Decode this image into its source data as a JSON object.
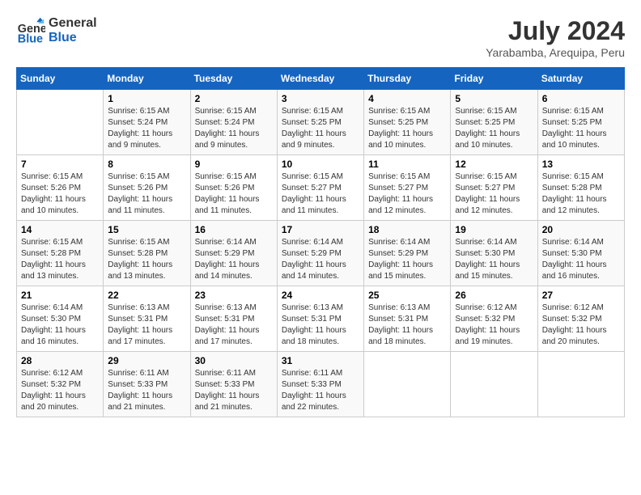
{
  "logo": {
    "line1": "General",
    "line2": "Blue"
  },
  "title": "July 2024",
  "location": "Yarabamba, Arequipa, Peru",
  "weekdays": [
    "Sunday",
    "Monday",
    "Tuesday",
    "Wednesday",
    "Thursday",
    "Friday",
    "Saturday"
  ],
  "weeks": [
    [
      {
        "day": "",
        "info": ""
      },
      {
        "day": "1",
        "info": "Sunrise: 6:15 AM\nSunset: 5:24 PM\nDaylight: 11 hours\nand 9 minutes."
      },
      {
        "day": "2",
        "info": "Sunrise: 6:15 AM\nSunset: 5:24 PM\nDaylight: 11 hours\nand 9 minutes."
      },
      {
        "day": "3",
        "info": "Sunrise: 6:15 AM\nSunset: 5:25 PM\nDaylight: 11 hours\nand 9 minutes."
      },
      {
        "day": "4",
        "info": "Sunrise: 6:15 AM\nSunset: 5:25 PM\nDaylight: 11 hours\nand 10 minutes."
      },
      {
        "day": "5",
        "info": "Sunrise: 6:15 AM\nSunset: 5:25 PM\nDaylight: 11 hours\nand 10 minutes."
      },
      {
        "day": "6",
        "info": "Sunrise: 6:15 AM\nSunset: 5:25 PM\nDaylight: 11 hours\nand 10 minutes."
      }
    ],
    [
      {
        "day": "7",
        "info": "Sunrise: 6:15 AM\nSunset: 5:26 PM\nDaylight: 11 hours\nand 10 minutes."
      },
      {
        "day": "8",
        "info": "Sunrise: 6:15 AM\nSunset: 5:26 PM\nDaylight: 11 hours\nand 11 minutes."
      },
      {
        "day": "9",
        "info": "Sunrise: 6:15 AM\nSunset: 5:26 PM\nDaylight: 11 hours\nand 11 minutes."
      },
      {
        "day": "10",
        "info": "Sunrise: 6:15 AM\nSunset: 5:27 PM\nDaylight: 11 hours\nand 11 minutes."
      },
      {
        "day": "11",
        "info": "Sunrise: 6:15 AM\nSunset: 5:27 PM\nDaylight: 11 hours\nand 12 minutes."
      },
      {
        "day": "12",
        "info": "Sunrise: 6:15 AM\nSunset: 5:27 PM\nDaylight: 11 hours\nand 12 minutes."
      },
      {
        "day": "13",
        "info": "Sunrise: 6:15 AM\nSunset: 5:28 PM\nDaylight: 11 hours\nand 12 minutes."
      }
    ],
    [
      {
        "day": "14",
        "info": "Sunrise: 6:15 AM\nSunset: 5:28 PM\nDaylight: 11 hours\nand 13 minutes."
      },
      {
        "day": "15",
        "info": "Sunrise: 6:15 AM\nSunset: 5:28 PM\nDaylight: 11 hours\nand 13 minutes."
      },
      {
        "day": "16",
        "info": "Sunrise: 6:14 AM\nSunset: 5:29 PM\nDaylight: 11 hours\nand 14 minutes."
      },
      {
        "day": "17",
        "info": "Sunrise: 6:14 AM\nSunset: 5:29 PM\nDaylight: 11 hours\nand 14 minutes."
      },
      {
        "day": "18",
        "info": "Sunrise: 6:14 AM\nSunset: 5:29 PM\nDaylight: 11 hours\nand 15 minutes."
      },
      {
        "day": "19",
        "info": "Sunrise: 6:14 AM\nSunset: 5:30 PM\nDaylight: 11 hours\nand 15 minutes."
      },
      {
        "day": "20",
        "info": "Sunrise: 6:14 AM\nSunset: 5:30 PM\nDaylight: 11 hours\nand 16 minutes."
      }
    ],
    [
      {
        "day": "21",
        "info": "Sunrise: 6:14 AM\nSunset: 5:30 PM\nDaylight: 11 hours\nand 16 minutes."
      },
      {
        "day": "22",
        "info": "Sunrise: 6:13 AM\nSunset: 5:31 PM\nDaylight: 11 hours\nand 17 minutes."
      },
      {
        "day": "23",
        "info": "Sunrise: 6:13 AM\nSunset: 5:31 PM\nDaylight: 11 hours\nand 17 minutes."
      },
      {
        "day": "24",
        "info": "Sunrise: 6:13 AM\nSunset: 5:31 PM\nDaylight: 11 hours\nand 18 minutes."
      },
      {
        "day": "25",
        "info": "Sunrise: 6:13 AM\nSunset: 5:31 PM\nDaylight: 11 hours\nand 18 minutes."
      },
      {
        "day": "26",
        "info": "Sunrise: 6:12 AM\nSunset: 5:32 PM\nDaylight: 11 hours\nand 19 minutes."
      },
      {
        "day": "27",
        "info": "Sunrise: 6:12 AM\nSunset: 5:32 PM\nDaylight: 11 hours\nand 20 minutes."
      }
    ],
    [
      {
        "day": "28",
        "info": "Sunrise: 6:12 AM\nSunset: 5:32 PM\nDaylight: 11 hours\nand 20 minutes."
      },
      {
        "day": "29",
        "info": "Sunrise: 6:11 AM\nSunset: 5:33 PM\nDaylight: 11 hours\nand 21 minutes."
      },
      {
        "day": "30",
        "info": "Sunrise: 6:11 AM\nSunset: 5:33 PM\nDaylight: 11 hours\nand 21 minutes."
      },
      {
        "day": "31",
        "info": "Sunrise: 6:11 AM\nSunset: 5:33 PM\nDaylight: 11 hours\nand 22 minutes."
      },
      {
        "day": "",
        "info": ""
      },
      {
        "day": "",
        "info": ""
      },
      {
        "day": "",
        "info": ""
      }
    ]
  ]
}
